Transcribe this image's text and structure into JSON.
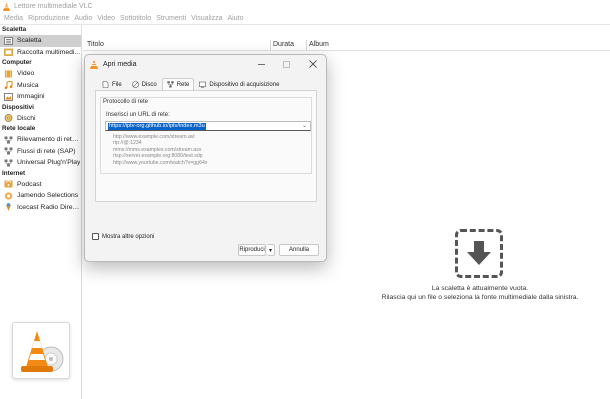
{
  "window": {
    "title": "Lettore multimediale VLC"
  },
  "menu": [
    "Media",
    "Riproduzione",
    "Audio",
    "Video",
    "Sottotitolo",
    "Strumenti",
    "Visualizza",
    "Aiuto"
  ],
  "sidebar": {
    "sections": [
      {
        "title": "Scaletta",
        "items": [
          {
            "label": "Scaletta",
            "icon": "playlist-icon",
            "active": true
          },
          {
            "label": "Raccolta multimedi...",
            "icon": "media-library-icon"
          }
        ]
      },
      {
        "title": "Computer",
        "items": [
          {
            "label": "Video",
            "icon": "video-icon"
          },
          {
            "label": "Musica",
            "icon": "music-icon"
          },
          {
            "label": "Immagini",
            "icon": "images-icon"
          }
        ]
      },
      {
        "title": "Dispositivi",
        "items": [
          {
            "label": "Dischi",
            "icon": "disc-icon"
          }
        ]
      },
      {
        "title": "Rete locale",
        "items": [
          {
            "label": "Rilevamento di rete...",
            "icon": "network-icon"
          },
          {
            "label": "Flussi di rete (SAP)",
            "icon": "network-icon"
          },
          {
            "label": "Universal Plug'n'Play",
            "icon": "network-icon"
          }
        ]
      },
      {
        "title": "Internet",
        "items": [
          {
            "label": "Podcast",
            "icon": "podcast-icon"
          },
          {
            "label": "Jamendo Selections",
            "icon": "jamendo-icon"
          },
          {
            "label": "Icecast Radio Direc...",
            "icon": "icecast-icon"
          }
        ]
      }
    ]
  },
  "playlist": {
    "columns": [
      "Titolo",
      "Durata",
      "Album"
    ],
    "empty_line1": "La scaletta è attualmente vuota.",
    "empty_line2": "Rilascia qui un file o seleziona la fonte multimediale dalla sinistra."
  },
  "dialog": {
    "title": "Apri media",
    "tabs": [
      {
        "label": "File",
        "icon": "file-icon"
      },
      {
        "label": "Disco",
        "icon": "disc-icon"
      },
      {
        "label": "Rete",
        "icon": "network-icon",
        "active": true
      },
      {
        "label": "Dispositivo di acquisizione",
        "icon": "capture-device-icon"
      }
    ],
    "group_title": "Protocollo di rete",
    "url_label": "Inserisci un URL di rete:",
    "url_value": "https://iptv-org.github.io/iptv/index.m3u",
    "examples": [
      "http://www.example.com/stream.avi",
      "rtp://@:1234",
      "mms://mms.examples.com/stream.asx",
      "rtsp://server.example.org:8080/test.sdp",
      "http://www.yourtube.com/watch?v=gg64x"
    ],
    "show_more": "Mostra altre opzioni",
    "play_button": "Riproduci",
    "play_dropdown": "▾",
    "cancel_button": "Annulla"
  }
}
